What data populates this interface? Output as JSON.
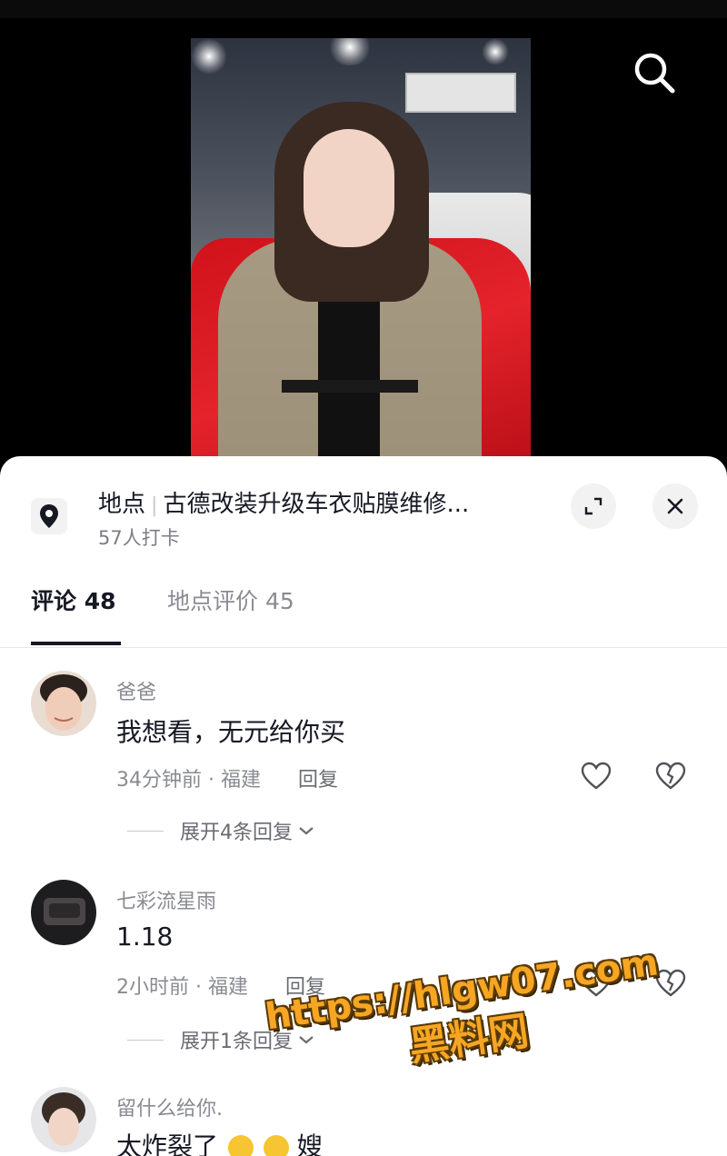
{
  "video": {
    "search_icon": "search-icon"
  },
  "location": {
    "label": "地点",
    "name": "古德改装升级车衣贴膜维修...",
    "checkins": "57人打卡",
    "pin_icon": "location-pin-icon",
    "expand_icon": "expand-icon",
    "close_icon": "close-icon"
  },
  "tabs": [
    {
      "label": "评论 48",
      "active": true
    },
    {
      "label": "地点评价 45",
      "active": false
    }
  ],
  "comments": [
    {
      "user": "爸爸",
      "text": "我想看，无元给你买",
      "time": "34分钟前",
      "region": "福建",
      "reply_label": "回复",
      "expand_label": "展开4条回复"
    },
    {
      "user": "七彩流星雨",
      "text": "1.18",
      "time": "2小时前",
      "region": "福建",
      "reply_label": "回复",
      "expand_label": "展开1条回复"
    },
    {
      "user": "留什么给你.",
      "text": "太炸裂了",
      "text_tail": "嫂"
    }
  ],
  "watermark": {
    "url": "https://hlgw07.com",
    "site": "黑料网"
  },
  "colors": {
    "accent_text": "#161823",
    "muted_text": "#8a8b91",
    "watermark": "#f6a623"
  }
}
